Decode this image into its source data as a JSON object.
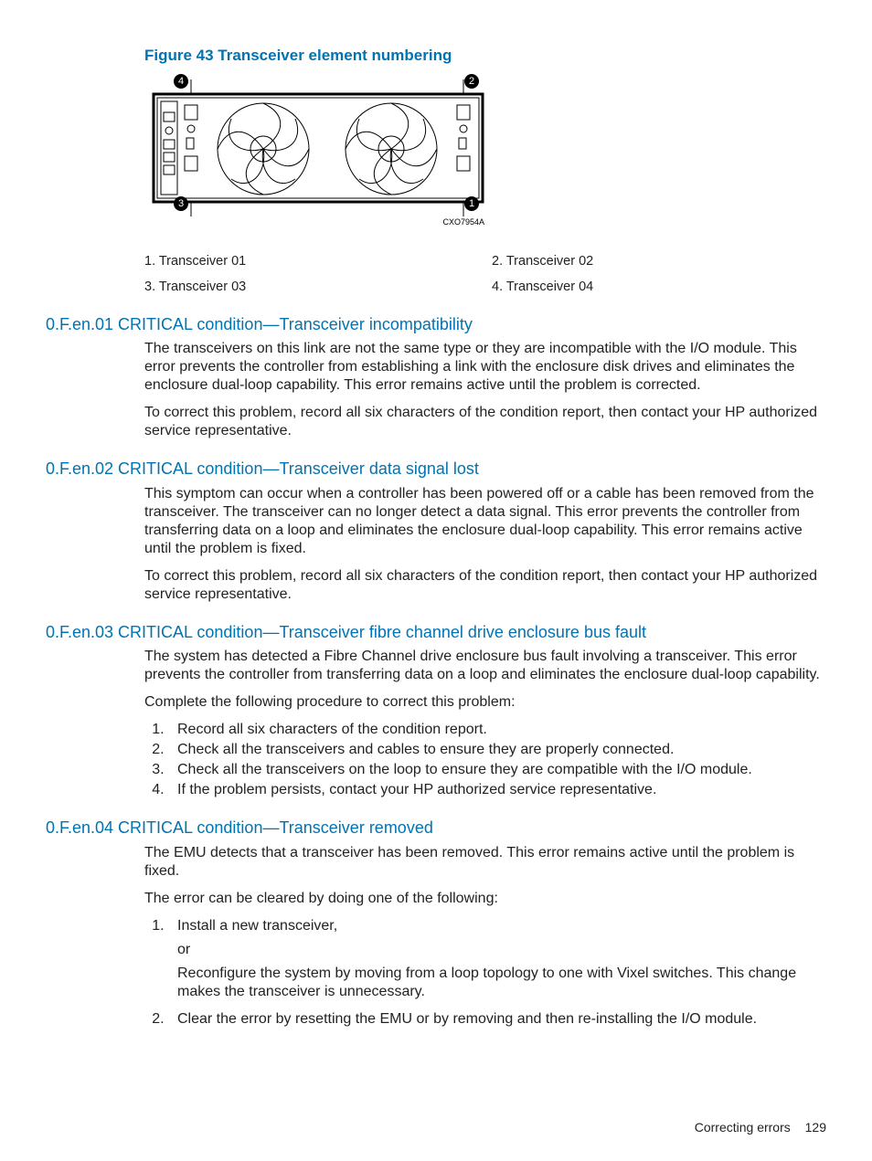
{
  "figure": {
    "title": "Figure 43 Transceiver element numbering",
    "code": "CXO7954A",
    "callouts": {
      "c1": "1",
      "c2": "2",
      "c3": "3",
      "c4": "4"
    },
    "legend": {
      "i1": "1. Transceiver 01",
      "i2": "2. Transceiver 02",
      "i3": "3. Transceiver 03",
      "i4": "4. Transceiver 04"
    }
  },
  "sections": {
    "s1": {
      "title": "0.F.en.01 CRITICAL condition—Transceiver incompatibility",
      "p1": "The transceivers on this link are not the same type or they are incompatible with the I/O module. This error prevents the controller from establishing a link with the enclosure disk drives and eliminates the enclosure dual-loop capability. This error remains active until the problem is corrected.",
      "p2": "To correct this problem, record all six characters of the condition report, then contact your HP authorized service representative."
    },
    "s2": {
      "title": "0.F.en.02 CRITICAL condition—Transceiver data signal lost",
      "p1": "This symptom can occur when a controller has been powered off or a cable has been removed from the transceiver. The transceiver can no longer detect a data signal. This error prevents the controller from transferring data on a loop and eliminates the enclosure dual-loop capability. This error remains active until the problem is fixed.",
      "p2": "To correct this problem, record all six characters of the condition report, then contact your HP authorized service representative."
    },
    "s3": {
      "title": "0.F.en.03 CRITICAL condition—Transceiver fibre channel drive enclosure bus fault",
      "p1": "The system has detected a Fibre Channel drive enclosure bus fault involving a transceiver. This error prevents the controller from transferring data on a loop and eliminates the enclosure dual-loop capability.",
      "p2": "Complete the following procedure to correct this problem:",
      "li1": "Record all six characters of the condition report.",
      "li2": "Check all the transceivers and cables to ensure they are properly connected.",
      "li3": "Check all the transceivers on the loop to ensure they are compatible with the I/O module.",
      "li4": "If the problem persists, contact your HP authorized service representative."
    },
    "s4": {
      "title": "0.F.en.04 CRITICAL condition—Transceiver removed",
      "p1": "The EMU detects that a transceiver has been removed. This error remains active until the problem is fixed.",
      "p2": "The error can be cleared by doing one of the following:",
      "li1": "Install a new transceiver,",
      "or": "or",
      "li1b": "Reconfigure the system by moving from a loop topology to one with Vixel switches. This change makes the transceiver is unnecessary.",
      "li2": "Clear the error by resetting the EMU or by removing and then re-installing the I/O module."
    }
  },
  "footer": {
    "label": "Correcting errors",
    "page": "129"
  }
}
